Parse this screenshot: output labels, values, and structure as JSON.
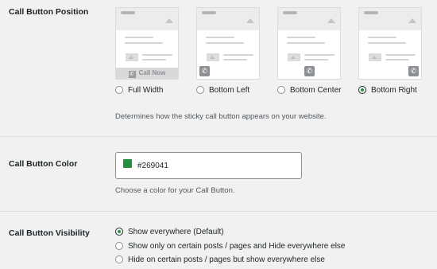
{
  "position": {
    "label": "Call Button Position",
    "options": [
      {
        "label": "Full Width",
        "checked": false,
        "bar_text": "Call Now"
      },
      {
        "label": "Bottom Left",
        "checked": false
      },
      {
        "label": "Bottom Center",
        "checked": false
      },
      {
        "label": "Bottom Right",
        "checked": true
      }
    ],
    "description": "Determines how the sticky call button appears on your website."
  },
  "color": {
    "label": "Call Button Color",
    "value": "#269041",
    "swatch_color": "#269041",
    "description": "Choose a color for your Call Button."
  },
  "visibility": {
    "label": "Call Button Visibility",
    "options": [
      {
        "label": "Show everywhere (Default)",
        "checked": true
      },
      {
        "label": "Show only on certain posts / pages and Hide everywhere else",
        "checked": false
      },
      {
        "label": "Hide on certain posts / pages but show everywhere else",
        "checked": false
      }
    ]
  },
  "icons": {
    "phone": "phone-icon",
    "image_placeholder": "image-placeholder-icon"
  }
}
